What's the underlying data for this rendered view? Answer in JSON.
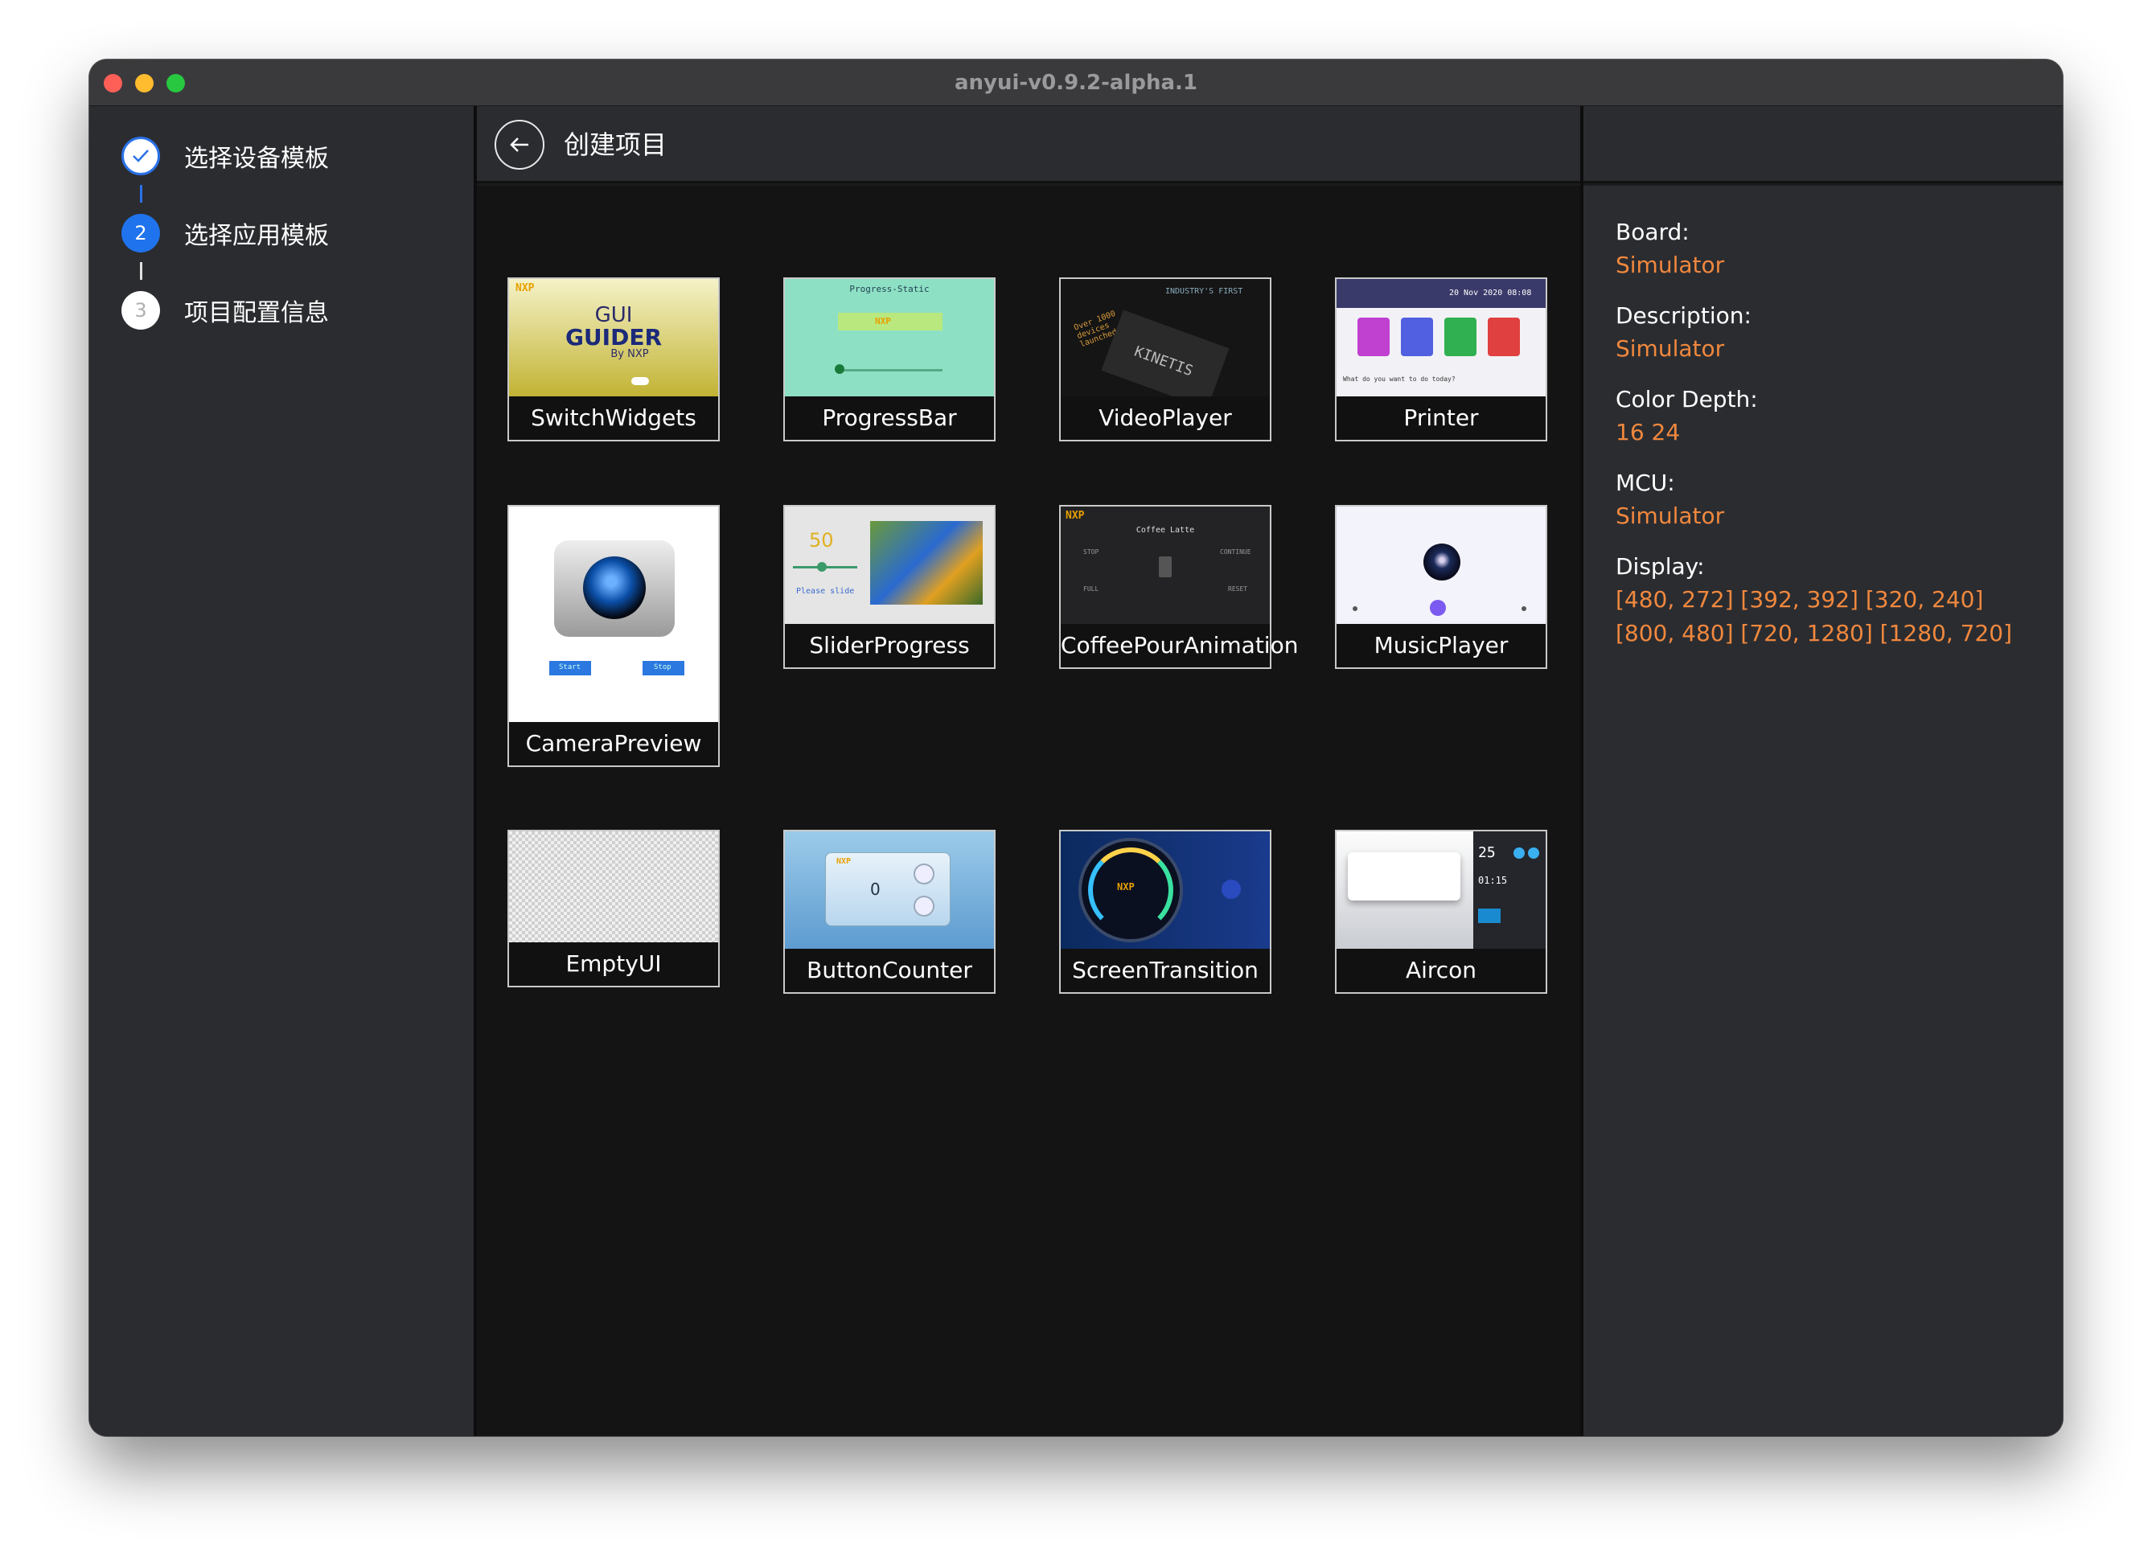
{
  "window": {
    "title": "anyui-v0.9.2-alpha.1"
  },
  "steps": [
    {
      "number": "",
      "label": "选择设备模板",
      "state": "done"
    },
    {
      "number": "2",
      "label": "选择应用模板",
      "state": "active"
    },
    {
      "number": "3",
      "label": "项目配置信息",
      "state": "pending"
    }
  ],
  "header": {
    "title": "创建项目",
    "back_icon": "arrow-left-icon"
  },
  "templates": [
    {
      "label": "SwitchWidgets"
    },
    {
      "label": "ProgressBar"
    },
    {
      "label": "VideoPlayer"
    },
    {
      "label": "Printer"
    },
    {
      "label": "CameraPreview"
    },
    {
      "label": "SliderProgress"
    },
    {
      "label": "CoffeePourAnimation"
    },
    {
      "label": "MusicPlayer"
    },
    {
      "label": "EmptyUI"
    },
    {
      "label": "ButtonCounter"
    },
    {
      "label": "ScreenTransition"
    },
    {
      "label": "Aircon"
    }
  ],
  "thumb_text": {
    "switch_gui": "GUI",
    "switch_guider": "GUIDER",
    "switch_by": "By NXP",
    "nxp": "NXP",
    "progress_title": "Progress-Static",
    "video_headline": "INDUSTRY'S FIRST",
    "video_over": "Over 1000 devices launched",
    "video_kinetis": "KINETIS",
    "printer_date": "20 Nov 2020 08:08",
    "printer_question": "What do you want to do today?",
    "camera_start": "Start",
    "camera_stop": "Stop",
    "slider_value": "50",
    "slider_hint": "Please slide",
    "coffee_title": "Coffee Latte",
    "coffee_stop": "STOP",
    "coffee_continue": "CONTINUE",
    "coffee_full": "FULL",
    "coffee_reset": "RESET",
    "counter_value": "0",
    "aircon_temp": "25",
    "aircon_time": "01:15"
  },
  "info": {
    "board_label": "Board:",
    "board_value": "Simulator",
    "description_label": "Description:",
    "description_value": "Simulator",
    "color_depth_label": "Color Depth:",
    "color_depth_value": "16 24",
    "mcu_label": "MCU:",
    "mcu_value": "Simulator",
    "display_label": "Display:",
    "display_value": "[480, 272] [392, 392] [320, 240] [800, 480] [720, 1280] [1280, 720]"
  },
  "colors": {
    "accent": "#1f73ec",
    "info_value": "#f0883e"
  }
}
